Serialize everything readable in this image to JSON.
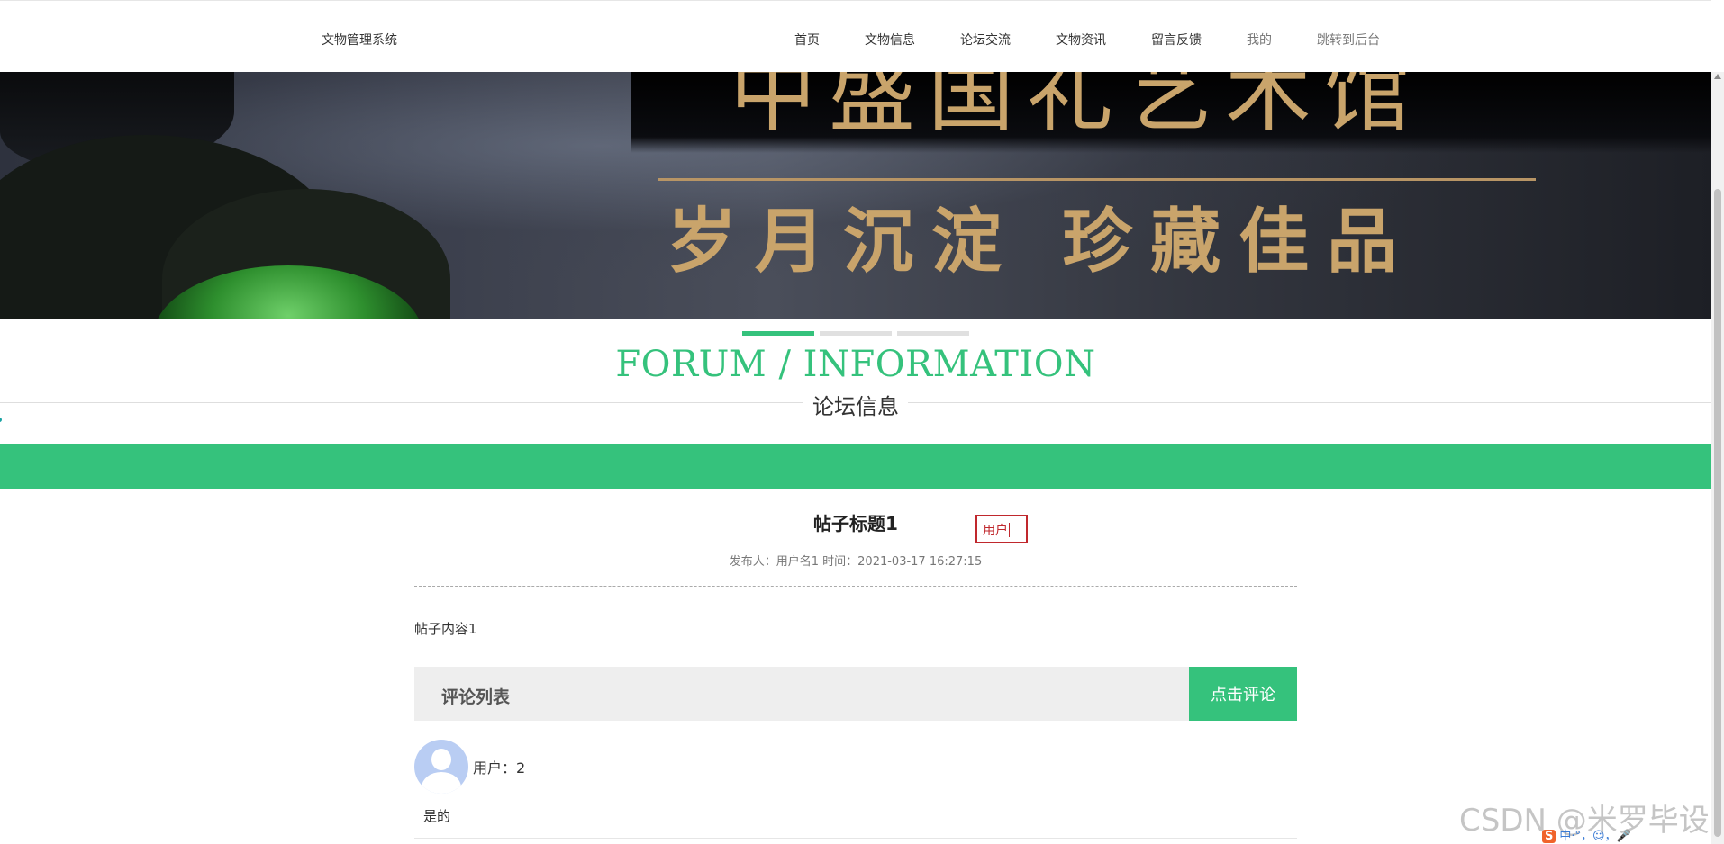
{
  "header": {
    "logo": "文物管理系统",
    "nav": [
      {
        "label": "首页"
      },
      {
        "label": "文物信息"
      },
      {
        "label": "论坛交流"
      },
      {
        "label": "文物资讯"
      },
      {
        "label": "留言反馈"
      },
      {
        "label": "我的"
      },
      {
        "label": "跳转到后台"
      }
    ]
  },
  "banner": {
    "line1": "中盛国礼艺术馆",
    "line2": "岁月沉淀 珍藏佳品",
    "slides": 3,
    "active_slide": 1
  },
  "section": {
    "title_en": "FORUM / INFORMATION",
    "title_cn": "论坛信息"
  },
  "post": {
    "title": "帖子标题1",
    "meta": "发布人：用户名1 时间：2021-03-17 16:27:15",
    "content": "帖子内容1",
    "annotation_input": "用户"
  },
  "comments": {
    "title": "评论列表",
    "button": "点击评论",
    "items": [
      {
        "user": "用户：2",
        "text": "是的"
      }
    ]
  },
  "watermark": "CSDN @米罗毕设",
  "ime": "中·°，☺，🎤"
}
